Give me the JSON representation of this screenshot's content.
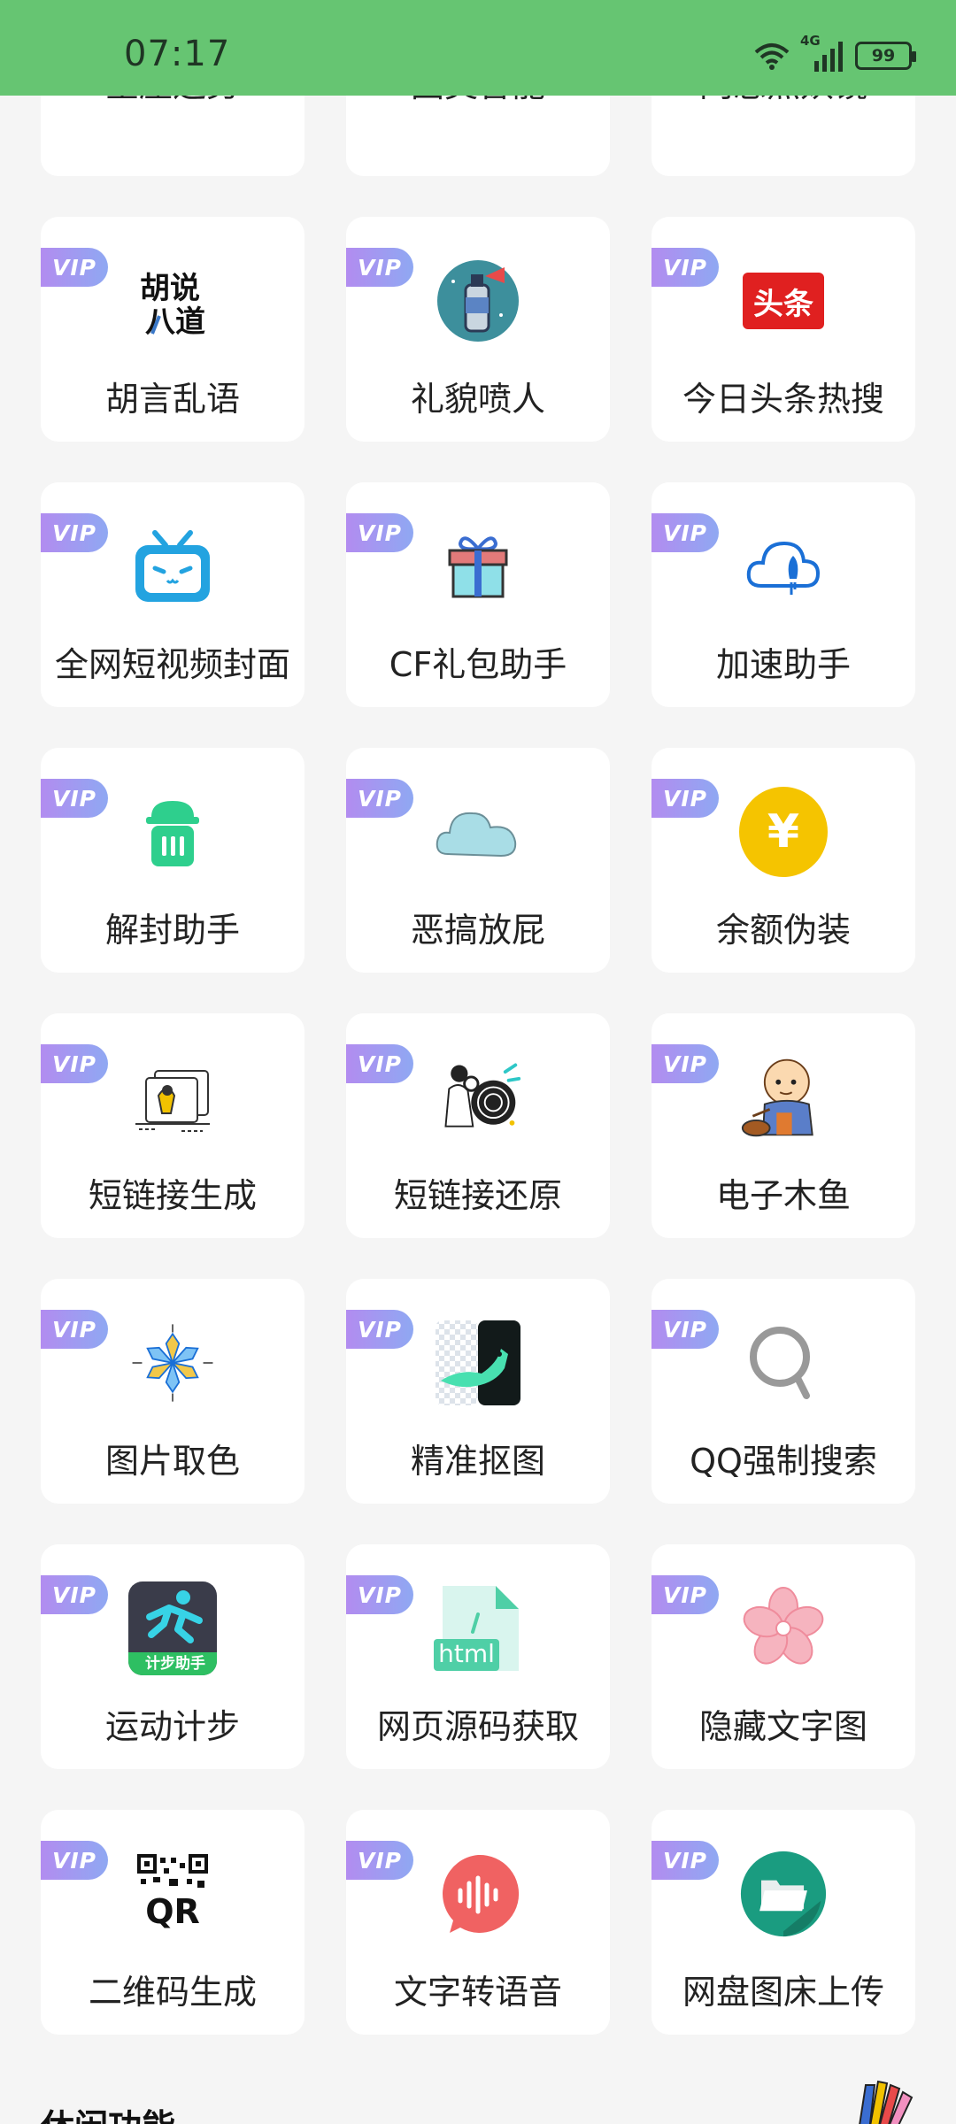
{
  "status_bar": {
    "time": "07:17",
    "network": "4G",
    "battery": "99"
  },
  "top_row": [
    "星座运势",
    "图灵智能",
    "网恋照妖镜"
  ],
  "vip_badge": "VIP",
  "tools": [
    {
      "label": "胡言乱语",
      "icon": "calligraphy-icon"
    },
    {
      "label": "礼貌喷人",
      "icon": "spray-can-icon"
    },
    {
      "label": "今日头条热搜",
      "icon": "toutiao-icon",
      "icon_text": "头条"
    },
    {
      "label": "全网短视频封面",
      "icon": "tv-face-icon"
    },
    {
      "label": "CF礼包助手",
      "icon": "gift-icon"
    },
    {
      "label": "加速助手",
      "icon": "cloud-rocket-icon"
    },
    {
      "label": "解封助手",
      "icon": "trash-can-icon"
    },
    {
      "label": "恶搞放屁",
      "icon": "cloud-icon"
    },
    {
      "label": "余额伪装",
      "icon": "yuan-coin-icon",
      "icon_text": "¥"
    },
    {
      "label": "短链接生成",
      "icon": "link-illustration-icon"
    },
    {
      "label": "短链接还原",
      "icon": "swirl-illustration-icon"
    },
    {
      "label": "电子木鱼",
      "icon": "monk-woodfish-icon"
    },
    {
      "label": "图片取色",
      "icon": "snowflake-palette-icon"
    },
    {
      "label": "精准抠图",
      "icon": "cutout-icon"
    },
    {
      "label": "QQ强制搜索",
      "icon": "search-icon"
    },
    {
      "label": "运动计步",
      "icon": "runner-icon",
      "icon_text": "计步助手"
    },
    {
      "label": "网页源码获取",
      "icon": "html-file-icon",
      "icon_text": "html"
    },
    {
      "label": "隐藏文字图",
      "icon": "sakura-icon"
    },
    {
      "label": "二维码生成",
      "icon": "qr-code-icon",
      "icon_text": "QR"
    },
    {
      "label": "文字转语音",
      "icon": "voice-bubble-icon"
    },
    {
      "label": "网盘图床上传",
      "icon": "folder-icon"
    }
  ],
  "section": {
    "title": "休闲功能"
  }
}
